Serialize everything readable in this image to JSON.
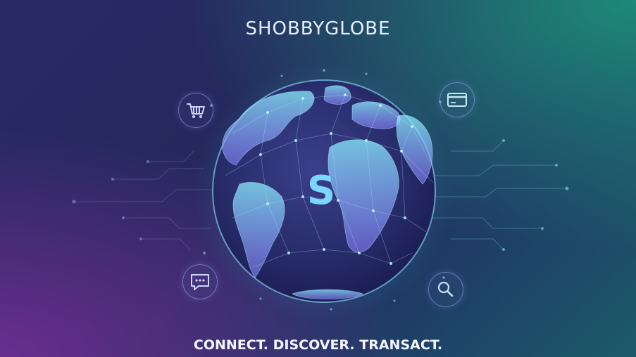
{
  "brand": {
    "name": "SHOBBYGLOBE",
    "monogram": "S",
    "tagline": "CONNECT. DISCOVER. TRANSACT."
  },
  "icons": [
    {
      "name": "shopping-cart-icon"
    },
    {
      "name": "credit-card-icon"
    },
    {
      "name": "chat-bubble-icon"
    },
    {
      "name": "search-icon"
    }
  ],
  "colors": {
    "accent_cyan": "#6fe3ff",
    "accent_purple": "#9b6bff",
    "text": "#e8eefc"
  }
}
